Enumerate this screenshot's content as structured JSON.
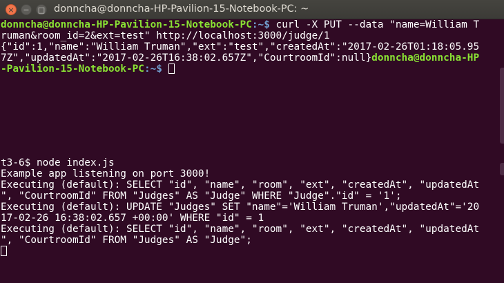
{
  "window": {
    "title": "donncha@donncha-HP-Pavilion-15-Notebook-PC: ~"
  },
  "icons": {
    "close": "close-icon",
    "minimize": "minimize-icon",
    "maximize": "maximize-icon"
  },
  "colors": {
    "background": "#300a24",
    "prompt_user": "#8ae234",
    "prompt_path": "#729fcf",
    "text": "#ffffff"
  },
  "top_pane": {
    "line1": {
      "prompt_user": "donncha@donncha-HP-Pavilion-15-Notebook-PC",
      "prompt_path": ":~$",
      "command": " curl -X PUT --data \"name=William T"
    },
    "line2": "ruman&room_id=2&ext=test\" http://localhost:3000/judge/1",
    "line3": "{\"id\":1,\"name\":\"William Truman\",\"ext\":\"test\",\"createdAt\":\"2017-02-26T01:18:05.95",
    "line4": {
      "text": "7Z\",\"updatedAt\":\"2017-02-26T16:38:02.657Z\",\"CourtroomId\":null}",
      "prompt_user": "donncha@donncha-HP"
    },
    "line5": {
      "prompt_user": "-Pavilion-15-Notebook-PC",
      "prompt_path": ":~$"
    }
  },
  "bottom_pane": {
    "lines": [
      "t3-6$ node index.js",
      "Example app listening on port 3000!",
      "Executing (default): SELECT \"id\", \"name\", \"room\", \"ext\", \"createdAt\", \"updatedAt",
      "\", \"CourtroomId\" FROM \"Judges\" AS \"Judge\" WHERE \"Judge\".\"id\" = '1';",
      "Executing (default): UPDATE \"Judges\" SET \"name\"='William Truman',\"updatedAt\"='20",
      "17-02-26 16:38:02.657 +00:00' WHERE \"id\" = 1",
      "Executing (default): SELECT \"id\", \"name\", \"room\", \"ext\", \"createdAt\", \"updatedAt",
      "\", \"CourtroomId\" FROM \"Judges\" AS \"Judge\";"
    ]
  }
}
